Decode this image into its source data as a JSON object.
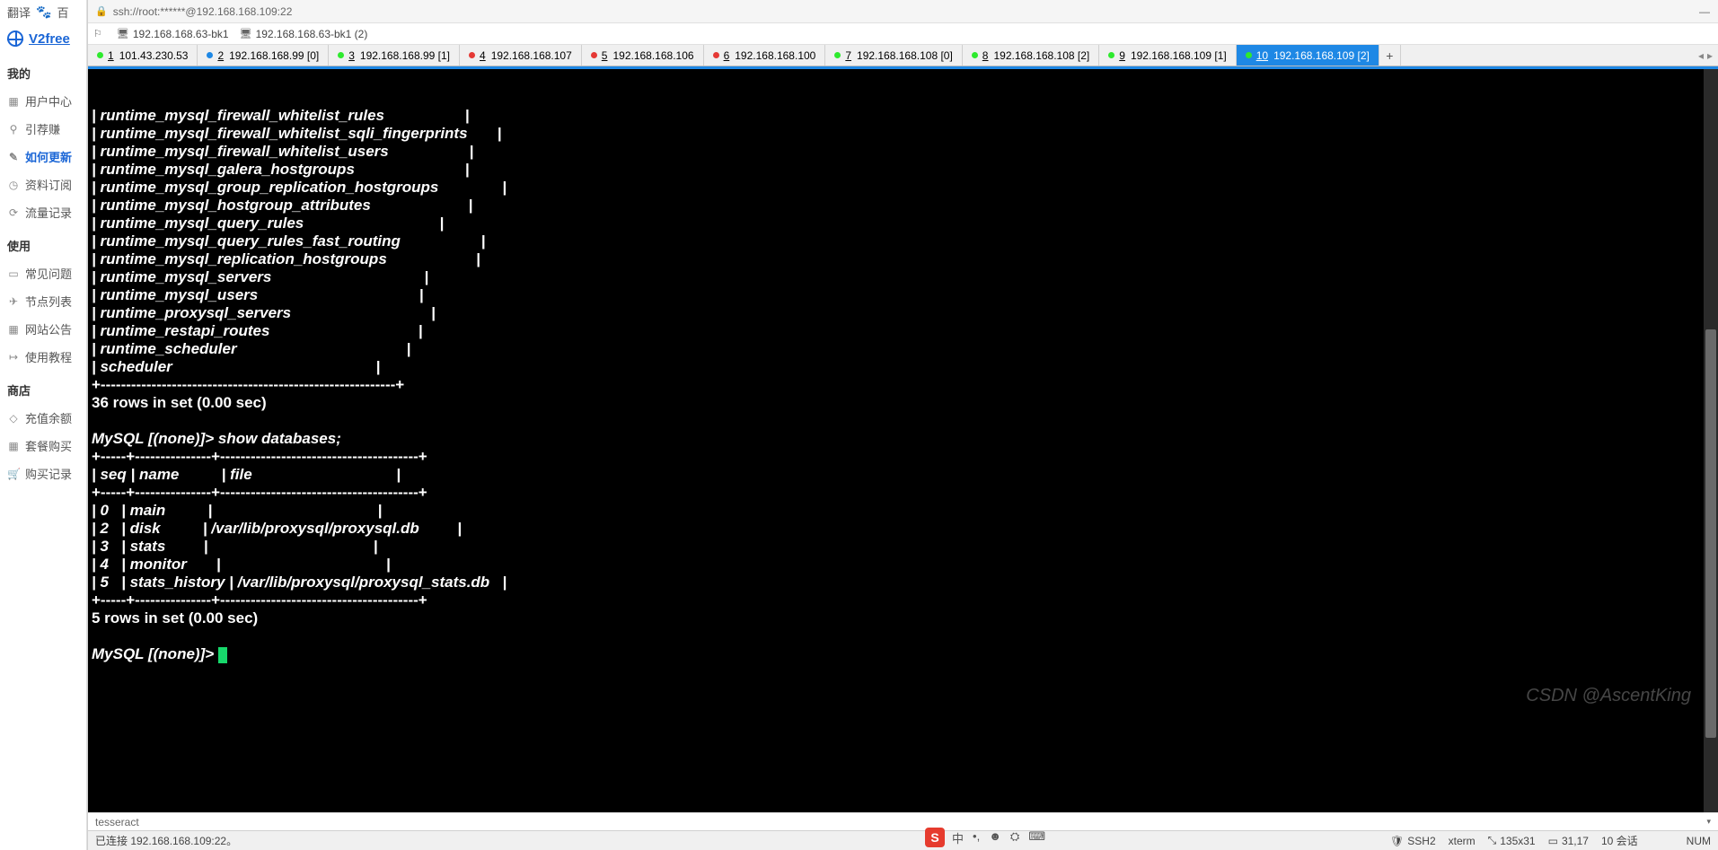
{
  "browser": {
    "top": {
      "translate": "翻译",
      "baidu": "百"
    },
    "logo": "V2free",
    "sections": {
      "mine": "我的",
      "use": "使用",
      "shop": "商店"
    },
    "nav_mine": [
      {
        "icon": "▦",
        "label": "用户中心"
      },
      {
        "icon": "⚲",
        "label": "引荐赚"
      },
      {
        "icon": "✎",
        "label": "如何更新",
        "active": true
      },
      {
        "icon": "◷",
        "label": "资料订阅"
      },
      {
        "icon": "⟳",
        "label": "流量记录"
      }
    ],
    "nav_use": [
      {
        "icon": "▭",
        "label": "常见问题"
      },
      {
        "icon": "✈",
        "label": "节点列表"
      },
      {
        "icon": "▦",
        "label": "网站公告"
      },
      {
        "icon": "↦",
        "label": "使用教程"
      }
    ],
    "nav_shop": [
      {
        "icon": "◇",
        "label": "充值余额"
      },
      {
        "icon": "▦",
        "label": "套餐购买"
      },
      {
        "icon": "🛒",
        "label": "购买记录"
      }
    ]
  },
  "titlebar": {
    "text": "ssh://root:******@192.168.168.109:22",
    "minimize": "—"
  },
  "bookmarks": [
    {
      "icon": "⚐",
      "label": ""
    },
    {
      "icon": "🖥",
      "label": "192.168.168.63-bk1"
    },
    {
      "icon": "🖥",
      "label": "192.168.168.63-bk1 (2)"
    }
  ],
  "tabs": [
    {
      "color": "#2eea2e",
      "num": "1",
      "label": "101.43.230.53"
    },
    {
      "color": "#1e88e5",
      "num": "2",
      "label": "192.168.168.99 [0]"
    },
    {
      "color": "#2eea2e",
      "num": "3",
      "label": "192.168.168.99 [1]"
    },
    {
      "color": "#e53935",
      "num": "4",
      "label": "192.168.168.107"
    },
    {
      "color": "#e53935",
      "num": "5",
      "label": "192.168.168.106"
    },
    {
      "color": "#e53935",
      "num": "6",
      "label": "192.168.168.100"
    },
    {
      "color": "#2eea2e",
      "num": "7",
      "label": "192.168.168.108 [0]"
    },
    {
      "color": "#2eea2e",
      "num": "8",
      "label": "192.168.168.108 [2]"
    },
    {
      "color": "#2eea2e",
      "num": "9",
      "label": "192.168.168.109 [1]"
    },
    {
      "color": "#2eea2e",
      "num": "10",
      "label": "192.168.168.109 [2]",
      "active": true
    }
  ],
  "tabs_add": "+",
  "tabs_nav": {
    "left": "◂",
    "right": "▸"
  },
  "terminal": {
    "tables_rows": [
      "| runtime_mysql_firewall_whitelist_rules                   |",
      "| runtime_mysql_firewall_whitelist_sqli_fingerprints       |",
      "| runtime_mysql_firewall_whitelist_users                   |",
      "| runtime_mysql_galera_hostgroups                          |",
      "| runtime_mysql_group_replication_hostgroups               |",
      "| runtime_mysql_hostgroup_attributes                       |",
      "| runtime_mysql_query_rules                                |",
      "| runtime_mysql_query_rules_fast_routing                   |",
      "| runtime_mysql_replication_hostgroups                     |",
      "| runtime_mysql_servers                                    |",
      "| runtime_mysql_users                                      |",
      "| runtime_proxysql_servers                                 |",
      "| runtime_restapi_routes                                   |",
      "| runtime_scheduler                                        |",
      "| scheduler                                                |"
    ],
    "tables_footer": "+----------------------------------------------------------+",
    "tables_summary": "36 rows in set (0.00 sec)",
    "blank": "",
    "cmd1": "MySQL [(none)]> show databases;",
    "db_sep": "+-----+---------------+---------------------------------------+",
    "db_header": "| seq | name          | file                                  |",
    "db_rows": [
      "| 0   | main          |                                       |",
      "| 2   | disk          | /var/lib/proxysql/proxysql.db         |",
      "| 3   | stats         |                                       |",
      "| 4   | monitor       |                                       |",
      "| 5   | stats_history | /var/lib/proxysql/proxysql_stats.db   |"
    ],
    "db_summary": "5 rows in set (0.00 sec)",
    "prompt": "MySQL [(none)]> "
  },
  "inputbar": {
    "value": "tesseract",
    "drop": "▾"
  },
  "status": {
    "connected": "已连接 192.168.168.109:22。",
    "ssh": "SSH2",
    "term": "xterm",
    "size": "135x31",
    "cursor": "31,17",
    "sessions": "10 会话",
    "caps": "NUM"
  },
  "watermark": "CSDN @AscentKing",
  "ime": {
    "badge": "S",
    "items": [
      "中",
      "•,",
      "☻",
      "⛭",
      "⌨"
    ]
  }
}
